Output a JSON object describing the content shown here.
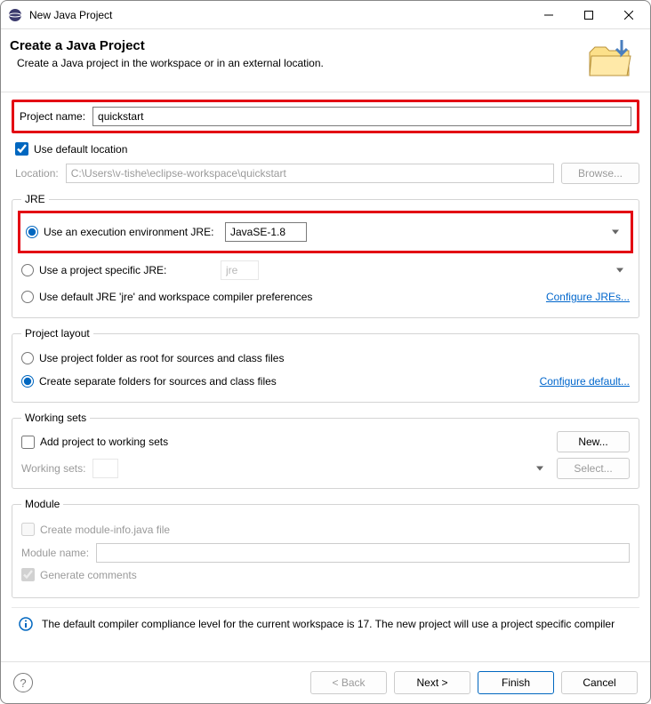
{
  "window": {
    "title": "New Java Project"
  },
  "header": {
    "title": "Create a Java Project",
    "subtitle": "Create a Java project in the workspace or in an external location."
  },
  "project_name": {
    "label": "Project name:",
    "value": "quickstart"
  },
  "default_location": {
    "checkbox_label": "Use default location",
    "location_label": "Location:",
    "location_value": "C:\\Users\\v-tishe\\eclipse-workspace\\quickstart",
    "browse_btn": "Browse..."
  },
  "jre": {
    "legend": "JRE",
    "exec_env_label": "Use an execution environment JRE:",
    "exec_env_value": "JavaSE-1.8",
    "project_specific_label": "Use a project specific JRE:",
    "project_specific_value": "jre",
    "default_jre_label": "Use default JRE 'jre' and workspace compiler preferences",
    "configure_link": "Configure JREs..."
  },
  "layout": {
    "legend": "Project layout",
    "root_label": "Use project folder as root for sources and class files",
    "separate_label": "Create separate folders for sources and class files",
    "configure_link": "Configure default..."
  },
  "working_sets": {
    "legend": "Working sets",
    "add_label": "Add project to working sets",
    "new_btn": "New...",
    "ws_label": "Working sets:",
    "select_btn": "Select..."
  },
  "module": {
    "legend": "Module",
    "create_label": "Create module-info.java file",
    "module_name_label": "Module name:",
    "generate_comments_label": "Generate comments"
  },
  "info_message": "The default compiler compliance level for the current workspace is 17. The new project will use a project specific compiler",
  "footer": {
    "back": "< Back",
    "next": "Next >",
    "finish": "Finish",
    "cancel": "Cancel"
  }
}
